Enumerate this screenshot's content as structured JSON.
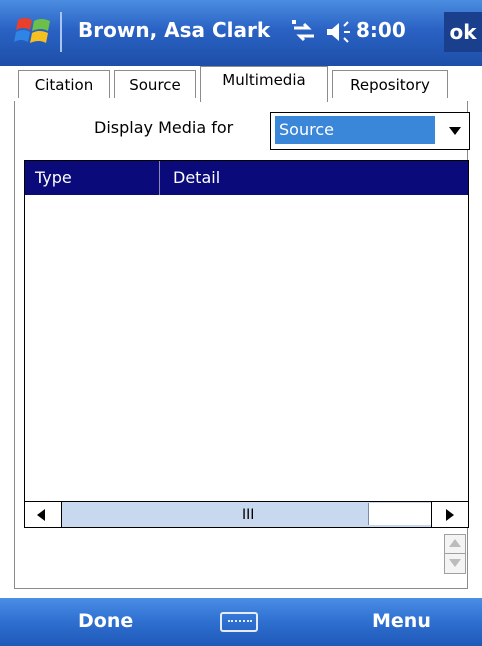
{
  "title_bar": {
    "app_title": "Brown, Asa Clark",
    "time": "8:00",
    "ok_label": "ok",
    "icons": [
      "windows-start-icon",
      "connectivity-icon",
      "volume-icon"
    ]
  },
  "tabs": [
    {
      "label": "Citation",
      "active": false
    },
    {
      "label": "Source",
      "active": false
    },
    {
      "label": "Multimedia",
      "active": true
    },
    {
      "label": "Repository",
      "active": false
    }
  ],
  "display_media": {
    "label": "Display Media for",
    "selected": "Source"
  },
  "list": {
    "columns": [
      "Type",
      "Detail"
    ],
    "rows": [],
    "scroll_grip": "III"
  },
  "menu_bar": {
    "left_softkey": "Done",
    "right_softkey": "Menu",
    "center_icon": "keyboard-icon"
  },
  "colors": {
    "title_bar": "#2a62c4",
    "list_header": "#0a0a7a",
    "selection": "#3a86d8",
    "menu_bar": "#2e6fd0"
  }
}
